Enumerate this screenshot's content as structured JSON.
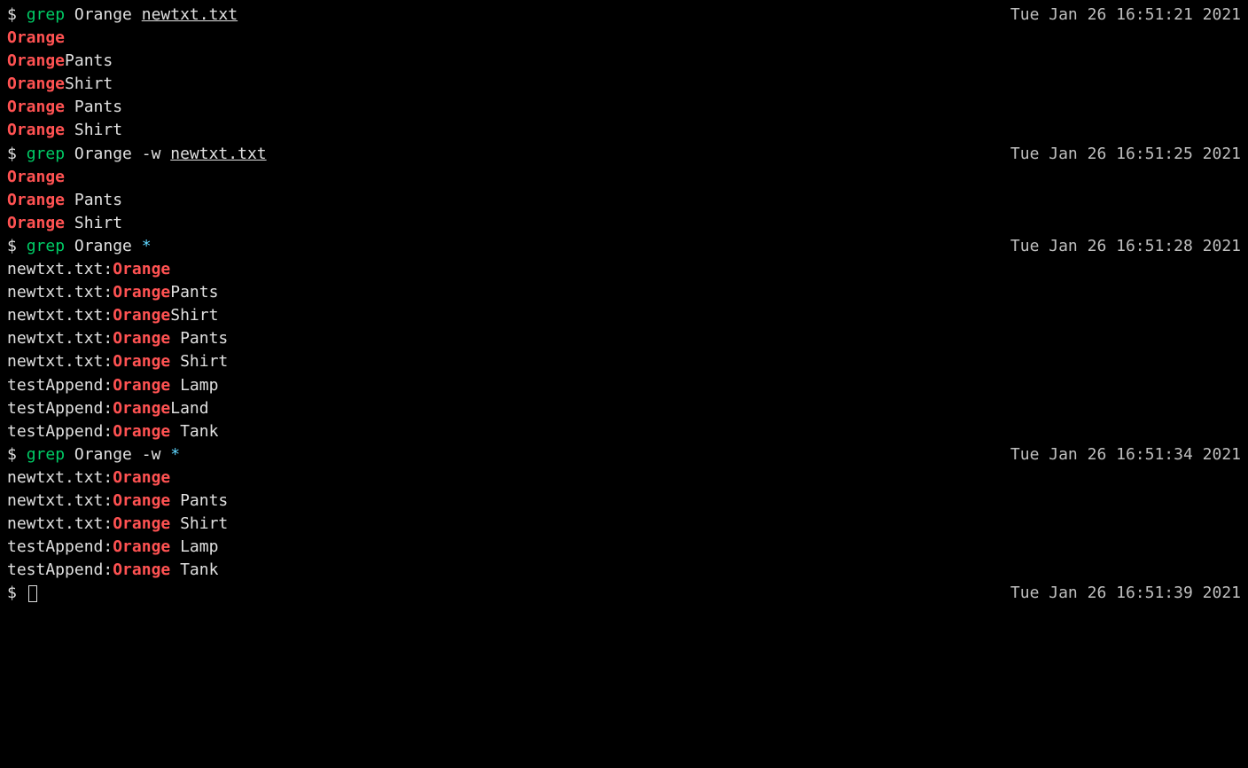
{
  "colors": {
    "bg": "#000000",
    "fg": "#e0e0e0",
    "cmd": "#00cc66",
    "match": "#ff5252",
    "wildcard": "#5fd7ff"
  },
  "prompt_symbol": "$",
  "commands": [
    {
      "cmd": "grep",
      "args_text": "Orange",
      "file": "newtxt.txt",
      "flag": "",
      "wildcard": "",
      "timestamp": "Tue Jan 26 16:51:21 2021",
      "output": [
        {
          "prefix": "",
          "match": "Orange",
          "suffix": ""
        },
        {
          "prefix": "",
          "match": "Orange",
          "suffix": "Pants"
        },
        {
          "prefix": "",
          "match": "Orange",
          "suffix": "Shirt"
        },
        {
          "prefix": "",
          "match": "Orange",
          "suffix": " Pants"
        },
        {
          "prefix": "",
          "match": "Orange",
          "suffix": " Shirt"
        }
      ]
    },
    {
      "cmd": "grep",
      "args_text": "Orange",
      "flag": "-w",
      "file": "newtxt.txt",
      "wildcard": "",
      "timestamp": "Tue Jan 26 16:51:25 2021",
      "output": [
        {
          "prefix": "",
          "match": "Orange",
          "suffix": ""
        },
        {
          "prefix": "",
          "match": "Orange",
          "suffix": " Pants"
        },
        {
          "prefix": "",
          "match": "Orange",
          "suffix": " Shirt"
        }
      ]
    },
    {
      "cmd": "grep",
      "args_text": "Orange",
      "flag": "",
      "file": "",
      "wildcard": "*",
      "timestamp": "Tue Jan 26 16:51:28 2021",
      "output": [
        {
          "prefix": "newtxt.txt:",
          "match": "Orange",
          "suffix": ""
        },
        {
          "prefix": "newtxt.txt:",
          "match": "Orange",
          "suffix": "Pants"
        },
        {
          "prefix": "newtxt.txt:",
          "match": "Orange",
          "suffix": "Shirt"
        },
        {
          "prefix": "newtxt.txt:",
          "match": "Orange",
          "suffix": " Pants"
        },
        {
          "prefix": "newtxt.txt:",
          "match": "Orange",
          "suffix": " Shirt"
        },
        {
          "prefix": "testAppend:",
          "match": "Orange",
          "suffix": " Lamp"
        },
        {
          "prefix": "testAppend:",
          "match": "Orange",
          "suffix": "Land"
        },
        {
          "prefix": "testAppend:",
          "match": "Orange",
          "suffix": " Tank"
        }
      ]
    },
    {
      "cmd": "grep",
      "args_text": "Orange",
      "flag": "-w",
      "file": "",
      "wildcard": "*",
      "timestamp": "Tue Jan 26 16:51:34 2021",
      "output": [
        {
          "prefix": "newtxt.txt:",
          "match": "Orange",
          "suffix": ""
        },
        {
          "prefix": "newtxt.txt:",
          "match": "Orange",
          "suffix": " Pants"
        },
        {
          "prefix": "newtxt.txt:",
          "match": "Orange",
          "suffix": " Shirt"
        },
        {
          "prefix": "testAppend:",
          "match": "Orange",
          "suffix": " Lamp"
        },
        {
          "prefix": "testAppend:",
          "match": "Orange",
          "suffix": " Tank"
        }
      ]
    }
  ],
  "final_prompt": {
    "timestamp": "Tue Jan 26 16:51:39 2021"
  }
}
